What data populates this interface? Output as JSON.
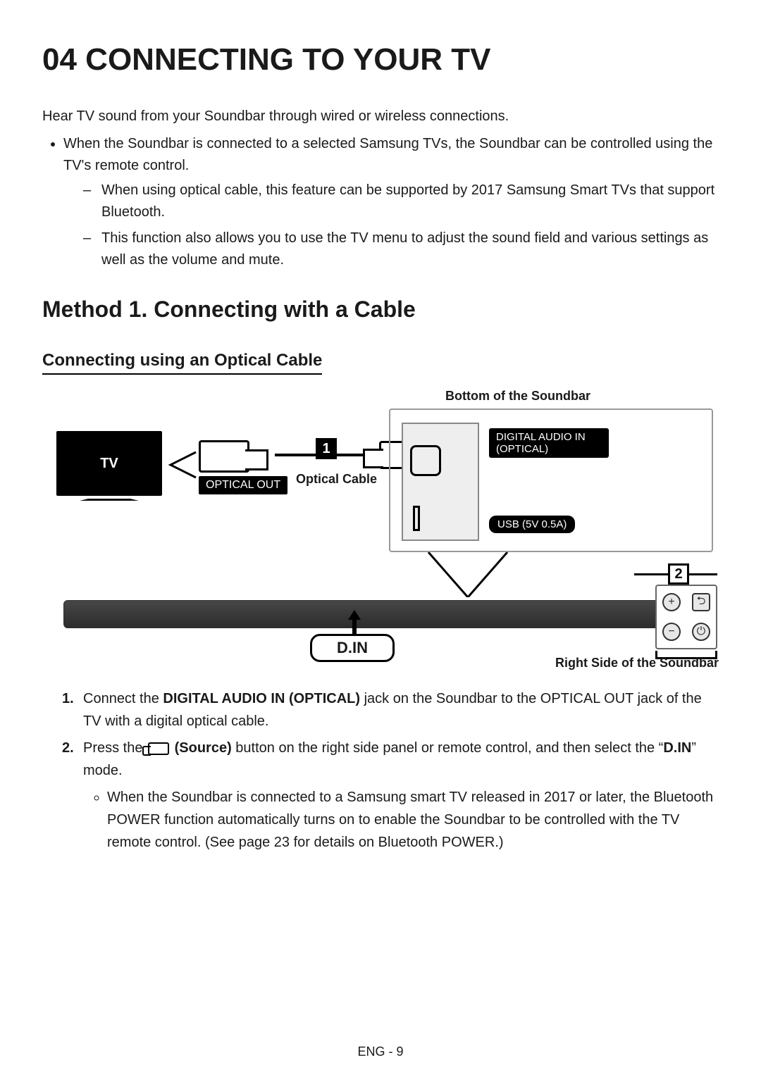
{
  "page_title": "04   CONNECTING TO YOUR TV",
  "intro": "Hear TV sound from your Soundbar through wired or wireless connections.",
  "bullet_main": "When the Soundbar is connected to a selected Samsung TVs, the Soundbar can be controlled using the TV's remote control.",
  "dash1": "When using optical cable, this feature can be supported by 2017 Samsung Smart TVs that support Bluetooth.",
  "dash2": "This function also allows you to use the TV menu to adjust the sound field and various settings as well as the volume and mute.",
  "method_heading": "Method 1. Connecting with a Cable",
  "sub_heading": "Connecting using an Optical Cable",
  "diagram": {
    "top_caption": "Bottom of the Soundbar",
    "right_caption": "Right Side of the Soundbar",
    "tv_label": "TV",
    "optical_out": "OPTICAL OUT",
    "optical_cable": "Optical Cable",
    "step1": "1",
    "digital_audio_in": "DIGITAL AUDIO IN (OPTICAL)",
    "usb_label": "USB (5V 0.5A)",
    "din": "D.IN",
    "step2": "2",
    "side_buttons": {
      "plus": "+",
      "minus": "−",
      "source": "⮌",
      "power": "⏻"
    }
  },
  "step1": {
    "pre": "Connect the ",
    "b1": "DIGITAL AUDIO IN (OPTICAL)",
    "mid": " jack on the Soundbar to the OPTICAL OUT jack of the TV with a digital optical cable."
  },
  "step2": {
    "pre": "Press the ",
    "b_source": "(Source)",
    "mid": " button on the right side panel or remote control, and then select the “",
    "b_din": "D.IN",
    "post": "” mode."
  },
  "step2_bullet": "When the Soundbar is connected to a Samsung smart TV released in 2017 or later, the Bluetooth POWER function automatically turns on to enable the Soundbar to be controlled with the TV remote control. (See page 23 for details on Bluetooth POWER.)",
  "page_number": "ENG - 9"
}
